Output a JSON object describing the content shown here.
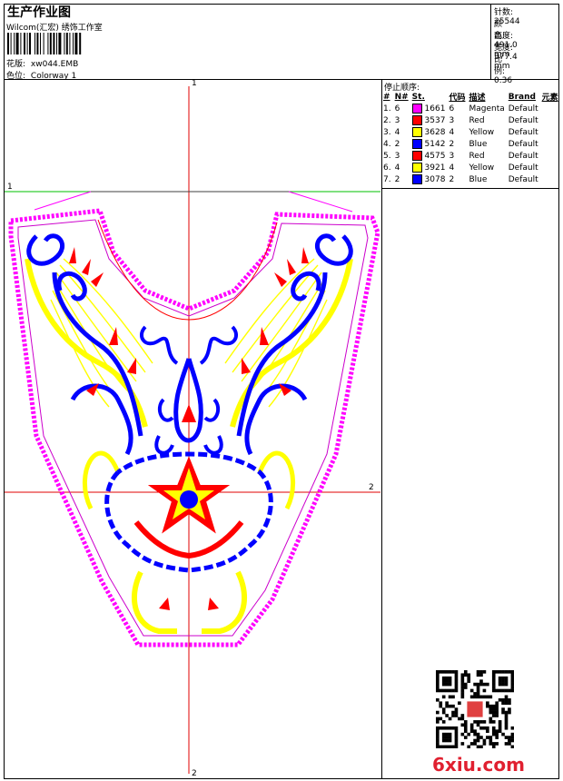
{
  "header": {
    "title": "生产作业图",
    "subtitle": "Wilcom(汇宏) 绣饰工作室",
    "design_label": "花版:",
    "design_value": "xw044.EMB",
    "colorway_label": "色位:",
    "colorway_value": "Colorway 1"
  },
  "stats": {
    "stitches_label": "针数:",
    "stitches_value": "25544",
    "colors_label": "颜色:",
    "colors_value": "4",
    "height_label": "高度:",
    "height_value": "491.0 mm",
    "width_label": "宽度:",
    "width_value": "377.4 mm",
    "scale_label": "比例:",
    "scale_value": "0.36"
  },
  "stop_sequence": {
    "title": "停止顺序:",
    "columns": [
      "#",
      "N#",
      "St.",
      "代码",
      "描述",
      "Brand",
      "元素"
    ],
    "rows": [
      {
        "idx": "1.",
        "needle": "6",
        "color": "#ff00ff",
        "st": "1661",
        "code": "6",
        "desc": "Magenta",
        "brand": "Default"
      },
      {
        "idx": "2.",
        "needle": "3",
        "color": "#ff0000",
        "st": "3537",
        "code": "3",
        "desc": "Red",
        "brand": "Default"
      },
      {
        "idx": "3.",
        "needle": "4",
        "color": "#ffff00",
        "st": "3628",
        "code": "4",
        "desc": "Yellow",
        "brand": "Default"
      },
      {
        "idx": "4.",
        "needle": "2",
        "color": "#0000ff",
        "st": "5142",
        "code": "2",
        "desc": "Blue",
        "brand": "Default"
      },
      {
        "idx": "5.",
        "needle": "3",
        "color": "#ff0000",
        "st": "4575",
        "code": "3",
        "desc": "Red",
        "brand": "Default"
      },
      {
        "idx": "6.",
        "needle": "4",
        "color": "#ffff00",
        "st": "3921",
        "code": "4",
        "desc": "Yellow",
        "brand": "Default"
      },
      {
        "idx": "7.",
        "needle": "2",
        "color": "#0000ff",
        "st": "3078",
        "code": "2",
        "desc": "Blue",
        "brand": "Default"
      }
    ]
  },
  "guides": {
    "top_label": "1",
    "left_label": "1",
    "right_label": "2",
    "bottom_label": "2"
  },
  "watermark": {
    "text": "6xiu.com"
  },
  "colors": {
    "magenta": "#ff00ff",
    "red": "#ff0000",
    "yellow": "#ffff00",
    "blue": "#0000ff",
    "guide_red": "#e00000",
    "guide_green": "#00c000"
  }
}
